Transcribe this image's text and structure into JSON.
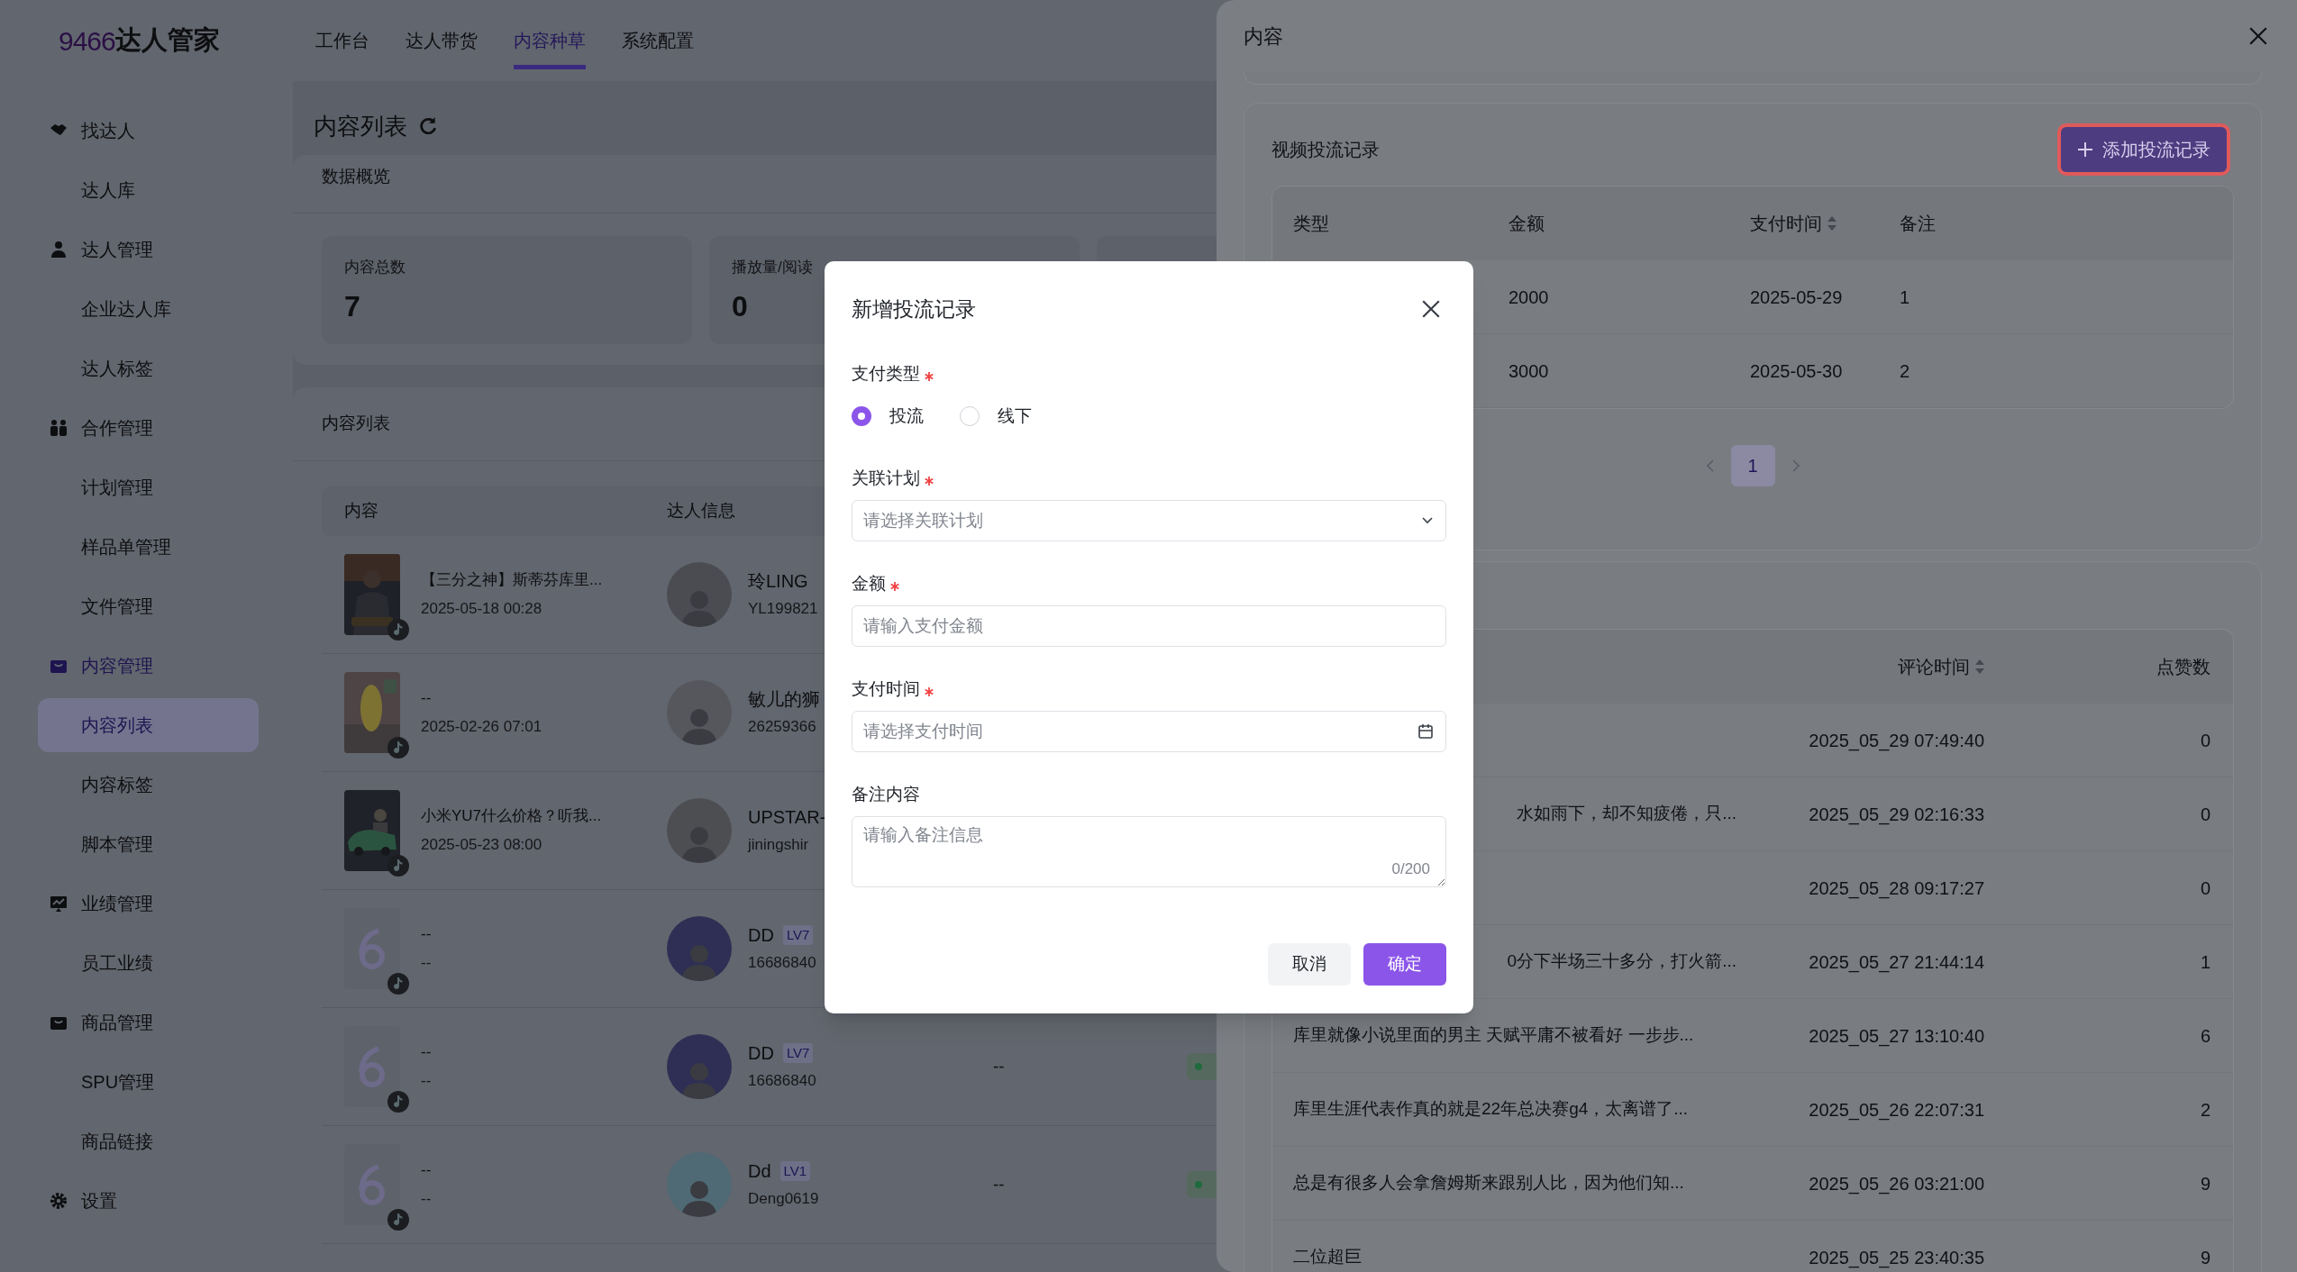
{
  "header": {
    "logo": {
      "number": "9466",
      "name": "达人管家"
    },
    "nav": [
      {
        "label": "工作台",
        "selected": false
      },
      {
        "label": "达人带货",
        "selected": false
      },
      {
        "label": "内容种草",
        "selected": true
      },
      {
        "label": "系统配置",
        "selected": false
      }
    ]
  },
  "sidebar": [
    {
      "label": "找达人",
      "selected": false,
      "children": [
        {
          "label": "达人库",
          "selected": false
        }
      ]
    },
    {
      "label": "达人管理",
      "selected": false,
      "children": [
        {
          "label": "企业达人库",
          "selected": false
        },
        {
          "label": "达人标签",
          "selected": false
        }
      ]
    },
    {
      "label": "合作管理",
      "selected": false,
      "children": [
        {
          "label": "计划管理",
          "selected": false
        },
        {
          "label": "样品单管理",
          "selected": false
        },
        {
          "label": "文件管理",
          "selected": false
        }
      ]
    },
    {
      "label": "内容管理",
      "selected": true,
      "children": [
        {
          "label": "内容列表",
          "selected": true
        },
        {
          "label": "内容标签",
          "selected": false
        },
        {
          "label": "脚本管理",
          "selected": false
        }
      ]
    },
    {
      "label": "业绩管理",
      "selected": false,
      "children": [
        {
          "label": "员工业绩",
          "selected": false
        }
      ]
    },
    {
      "label": "商品管理",
      "selected": false,
      "children": [
        {
          "label": "SPU管理",
          "selected": false
        },
        {
          "label": "商品链接",
          "selected": false
        }
      ]
    },
    {
      "label": "设置",
      "selected": false
    }
  ],
  "page": {
    "title": "内容列表",
    "overview": {
      "title": "数据概览",
      "stats": [
        {
          "label": "内容总数",
          "value": "7"
        },
        {
          "label": "播放量/阅读",
          "value": "0"
        }
      ]
    },
    "list": {
      "title": "内容列表",
      "columns": [
        "内容",
        "达人信息"
      ],
      "rows": [
        {
          "title": "【三分之神】斯蒂芬库里...",
          "date": "2025-05-18 00:28",
          "name": "玲LING",
          "id": "YL199821"
        },
        {
          "title": "--",
          "date": "2025-02-26 07:01",
          "name": "敏儿的狮",
          "id": "26259366"
        },
        {
          "title": "小米YU7什么价格？听我...",
          "date": "2025-05-23 08:00",
          "name": "UPSTAR-",
          "id": "jiningshir"
        },
        {
          "kind": "placeholder",
          "title": "--",
          "date": "--",
          "name": "DD",
          "level": "LV7",
          "id": "16686840"
        },
        {
          "kind": "placeholder",
          "title": "--",
          "date": "--",
          "name": "DD",
          "level": "LV7",
          "id": "16686840",
          "column_3": "--",
          "tag": true
        },
        {
          "kind": "placeholder",
          "title": "--",
          "date": "--",
          "name": "Dd",
          "level": "LV1",
          "id": "Deng0619",
          "column_3": "--",
          "tag": true
        }
      ]
    }
  },
  "drawer": {
    "title": "内容",
    "payments": {
      "title": "视频投流记录",
      "add_button": "添加投流记录",
      "columns": [
        {
          "label": "类型"
        },
        {
          "label": "金额"
        },
        {
          "label": "支付时间",
          "sortable": true
        },
        {
          "label": "备注"
        }
      ],
      "rows": [
        {
          "amount": "2000",
          "time": "2025-05-29",
          "note": "1"
        },
        {
          "amount": "3000",
          "time": "2025-05-30",
          "note": "2"
        }
      ],
      "pages": [
        {
          "label": "1",
          "selected": true
        }
      ]
    },
    "comments": {
      "columns": [
        {
          "label": "评论时间",
          "sortable": true
        },
        {
          "label": "点赞数"
        }
      ],
      "rows": [
        {
          "time": "2025_05_29 07:49:40",
          "likes": "0"
        },
        {
          "comment": "水如雨下，却不知疲倦，只...",
          "kind": "partial",
          "time": "2025_05_29 02:16:33",
          "likes": "0"
        },
        {
          "time": "2025_05_28 09:17:27",
          "likes": "0"
        },
        {
          "comment": "0分下半场三十多分，打火箭...",
          "kind": "partial",
          "time": "2025_05_27 21:44:14",
          "likes": "1"
        },
        {
          "comment": "库里就像小说里面的男主 天赋平庸不被看好 一步步...",
          "kind": "full",
          "time": "2025_05_27 13:10:40",
          "likes": "6"
        },
        {
          "comment": "库里生涯代表作真的就是22年总决赛g4，太离谱了...",
          "kind": "full",
          "time": "2025_05_26 22:07:31",
          "likes": "2"
        },
        {
          "comment": "总是有很多人会拿詹姆斯来跟别人比，因为他们知...",
          "kind": "full",
          "time": "2025_05_26 03:21:00",
          "likes": "9"
        },
        {
          "comment": "二位超巨",
          "kind": "full",
          "time": "2025_05_25 23:40:35",
          "likes": "9"
        }
      ]
    }
  },
  "dialog": {
    "title": "新增投流记录",
    "fields": [
      {
        "kind": "radio",
        "label": "支付类型",
        "required": true,
        "options": [
          {
            "label": "投流",
            "selected": true
          },
          {
            "label": "线下",
            "selected": false
          }
        ]
      },
      {
        "kind": "select",
        "label": "关联计划",
        "required": true,
        "placeholder": "请选择关联计划"
      },
      {
        "kind": "input",
        "label": "金额",
        "required": true,
        "placeholder": "请输入支付金额"
      },
      {
        "kind": "date",
        "label": "支付时间",
        "required": true,
        "placeholder": "请选择支付时间"
      },
      {
        "kind": "textarea",
        "label": "备注内容",
        "required": false,
        "placeholder": "请输入备注信息",
        "counter": "0/200"
      }
    ],
    "buttons": [
      {
        "label": "取消",
        "kind": "secondary"
      },
      {
        "label": "确定",
        "kind": "primary"
      }
    ]
  }
}
